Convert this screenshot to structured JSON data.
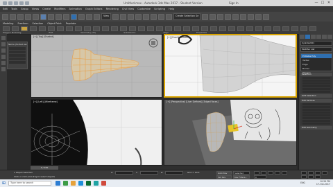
{
  "window": {
    "title": "Untitled.max - Autodesk 3ds Max 2017 - Student Version",
    "sign_in": "Sign In",
    "controls": [
      "—",
      "□",
      "✕"
    ]
  },
  "menu": [
    "Edit",
    "Tools",
    "Group",
    "Views",
    "Create",
    "Modifiers",
    "Animation",
    "Graph Editors",
    "Rendering",
    "Civil View",
    "Customize",
    "Scripting",
    "Help"
  ],
  "toolbar": {
    "view_dropdown": "View",
    "selection_set": "Create Selection Se"
  },
  "ribbon": {
    "tabs": [
      "Modeling",
      "Freeform",
      "Selection",
      "Object Paint",
      "Populate"
    ],
    "groups": [
      "Polygon Modeling",
      "Edit",
      "Geometry (All)",
      "Subdivision",
      "Align",
      "Properties"
    ]
  },
  "left_panel": {
    "header": "Name (Sorted Ascen"
  },
  "viewports": {
    "top": "[+] [Top] [Shaded]",
    "front": "[+] [Front] [Shaded]",
    "left": "[+] [Left] [Wireframe]",
    "perspective": "[+] [Perspective] [User Defined] [Edged Faces]"
  },
  "command_panel": {
    "object_name": "Cylinder001",
    "modifier_list": "Modifier List",
    "stack": [
      "Editable Poly",
      "Vertex",
      "Edge",
      "Border",
      "Polygon"
    ],
    "stack_selected": 0,
    "rollouts": [
      "Selection",
      "Soft Selection",
      "Edit Vertices",
      "Edit Geometry"
    ]
  },
  "timeline": {
    "slider": "0 / 100"
  },
  "status": {
    "selected": "1 Object Selected",
    "prompt": "Click or click-and-drag to select objects",
    "x": "X:",
    "y": "Y:",
    "z": "Z:",
    "grid": "Grid = 10.0",
    "auto_key": "Auto Key",
    "selected_dd": "Selected",
    "set_key": "Set Key",
    "key_filters": "Key Filters...",
    "frame": "0"
  },
  "taskbar": {
    "search": "Type here to search",
    "app_colors": [
      "#2d7dd2",
      "#3d9c47",
      "#e6a23c",
      "#1f8fdb",
      "#0b6b2f",
      "#1fa3a3",
      "#d04a3c"
    ],
    "tray_icons": "ENG",
    "time": "10:59 PM",
    "date": "17-Oct-2017"
  }
}
